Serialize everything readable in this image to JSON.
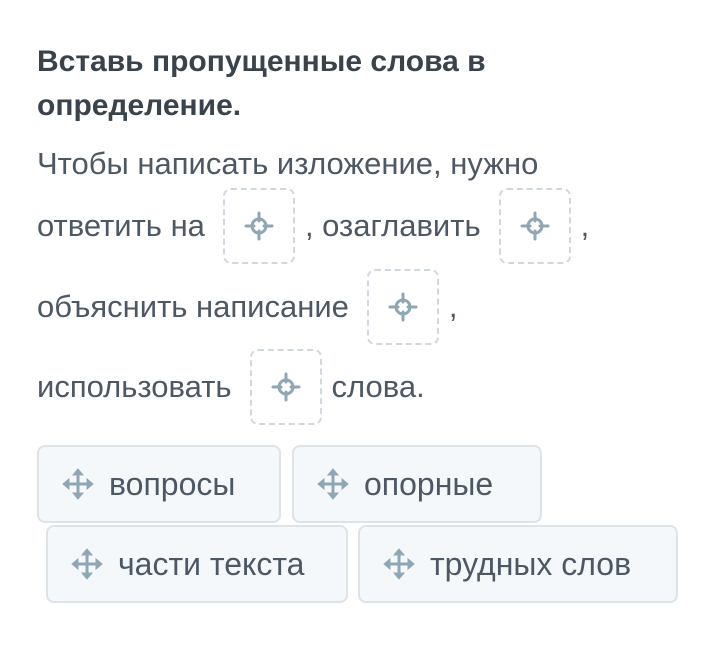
{
  "task": {
    "title": "Вставь пропущенные слова в определение."
  },
  "sentence": {
    "part1": "Чтобы написать изложение, нужно",
    "part2": "ответить на",
    "part3": ", озаглавить",
    "part4": ",",
    "part5": "объяснить написание",
    "part6": ",",
    "part7": "использовать",
    "part8": "слова."
  },
  "options": [
    {
      "label": "вопросы",
      "icon": "move-icon"
    },
    {
      "label": "опорные",
      "icon": "move-icon"
    },
    {
      "label": "части текста",
      "icon": "move-icon"
    },
    {
      "label": "трудных слов",
      "icon": "move-icon"
    }
  ],
  "colors": {
    "title": "#3a434c",
    "text": "#4d5864",
    "icon": "#8fa7b5",
    "dashed_border": "#cfd8de",
    "chip_bg": "#f5f8fa",
    "chip_border": "#dde4e8"
  }
}
